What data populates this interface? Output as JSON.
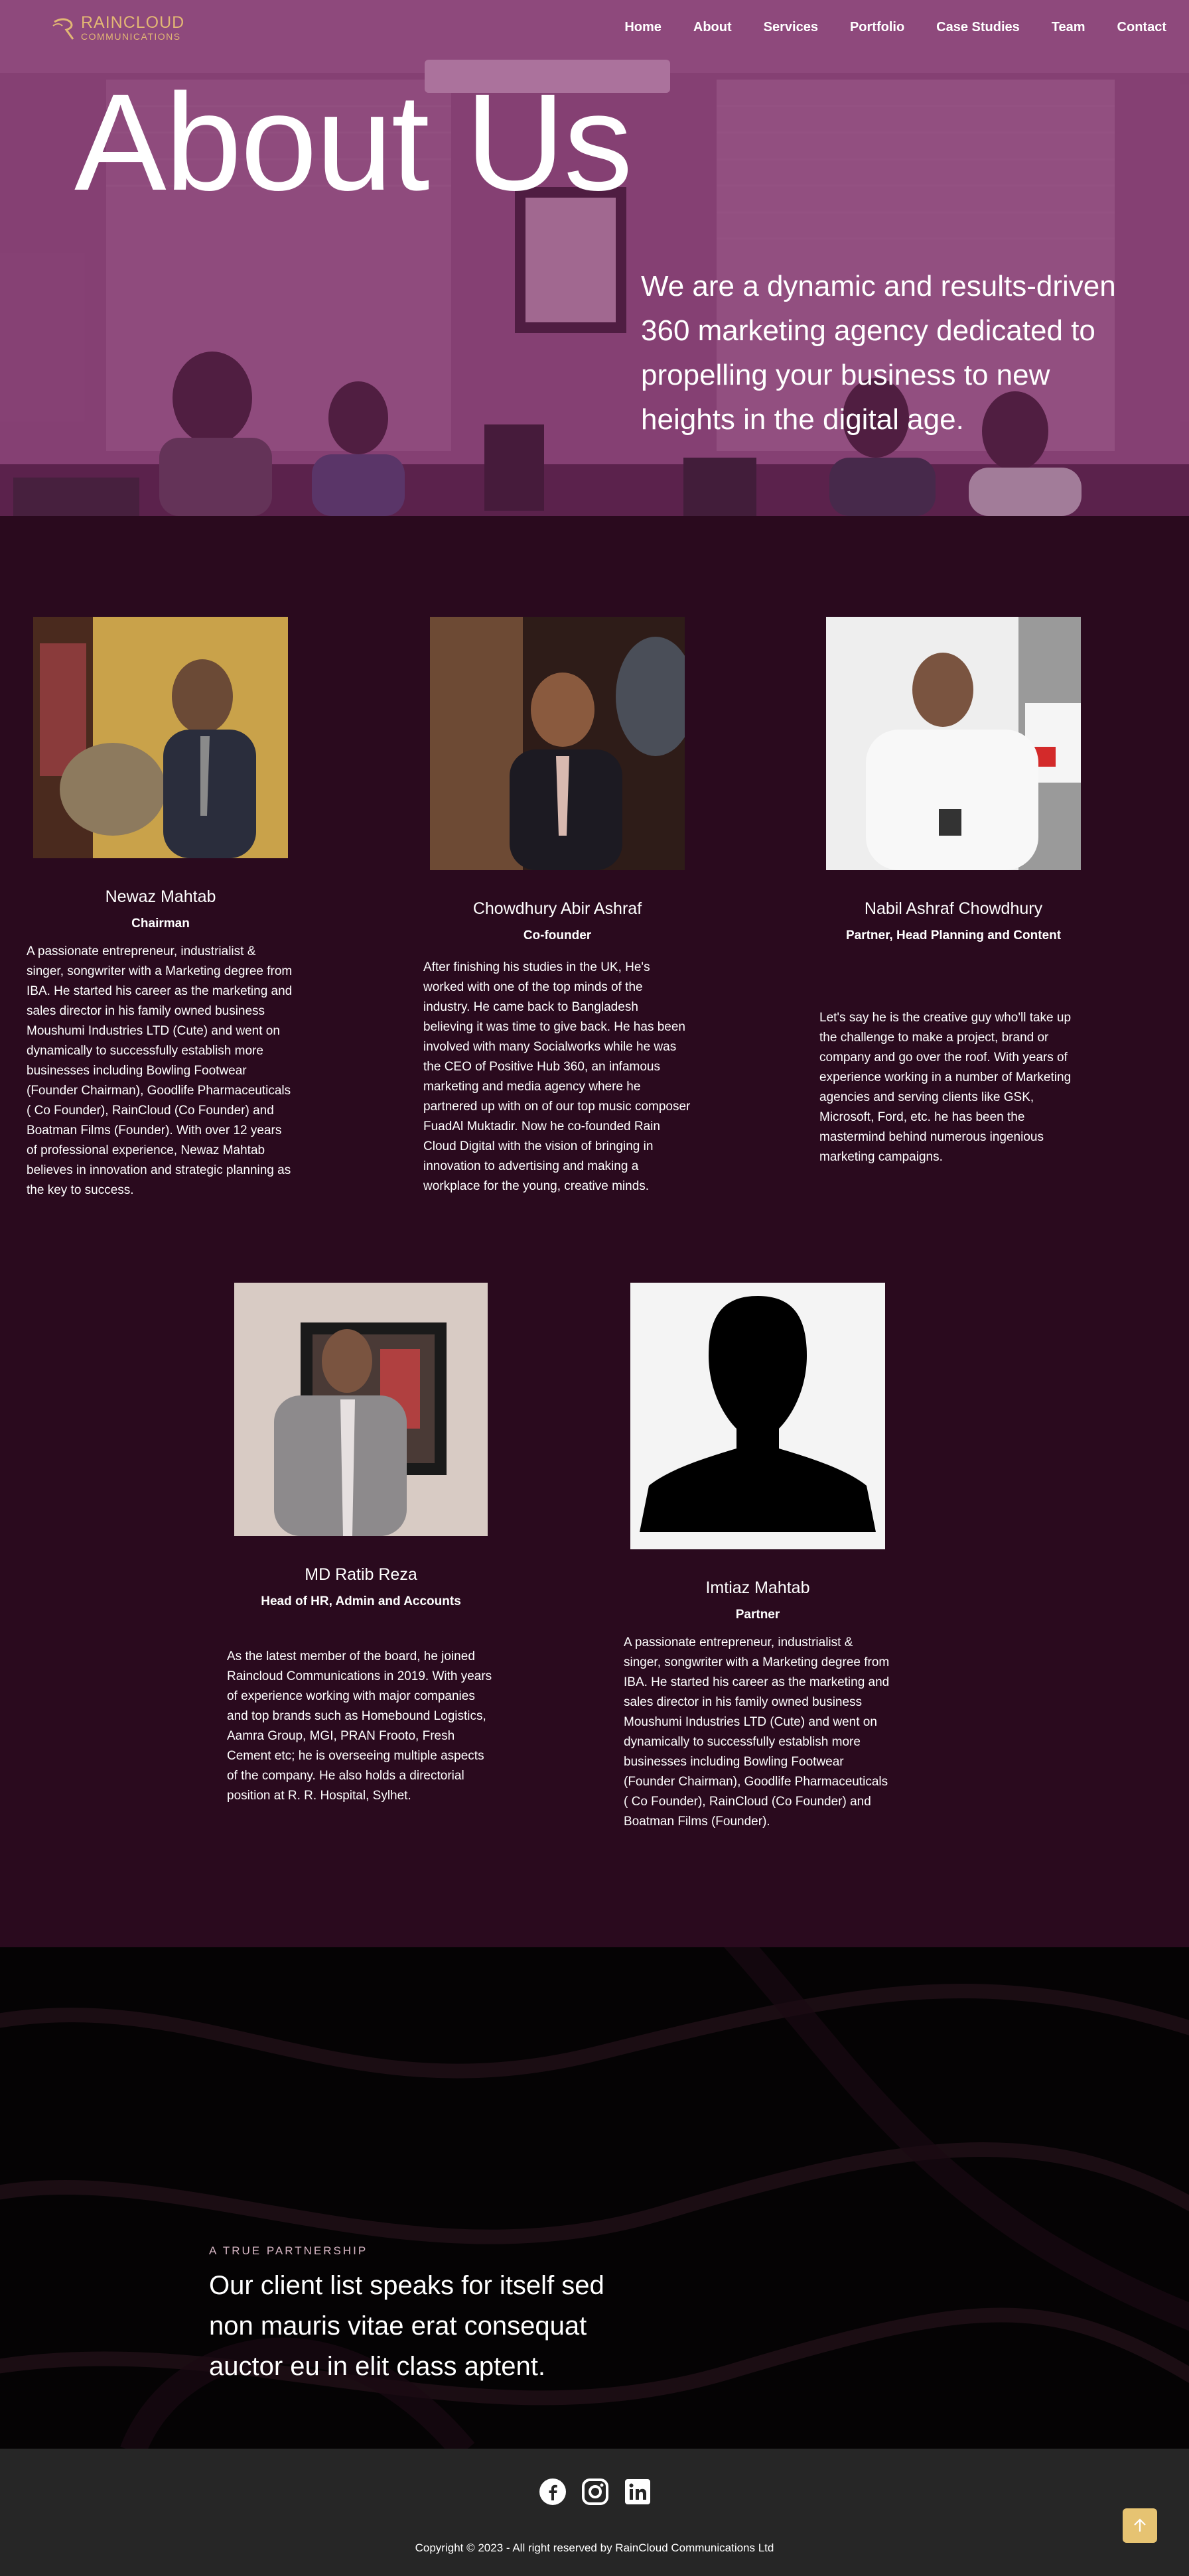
{
  "brand": {
    "name_line1": "RAINCLOUD",
    "name_line2": "COMMUNICATIONS",
    "accent": "#e2b774"
  },
  "nav": {
    "items": [
      "Home",
      "About",
      "Services",
      "Portfolio",
      "Case Studies",
      "Team",
      "Contact"
    ]
  },
  "hero": {
    "title": "About Us",
    "tagline": "We are a dynamic and results-driven 360 marketing agency dedicated to propelling your business to new heights in the digital age."
  },
  "team": [
    {
      "name": "Newaz Mahtab",
      "role": "Chairman",
      "bio": "A passionate entrepreneur, industrialist & singer, songwriter with a Marketing degree from IBA. He started his career as the marketing and sales director in his family owned business Moushumi Industries LTD (Cute) and went on dynamically to successfully establish more businesses including Bowling Footwear (Founder Chairman), Goodlife Pharmaceuticals ( Co Founder), RainCloud (Co Founder) and Boatman Films (Founder). With over 12 years of professional experience, Newaz Mahtab believes in innovation and strategic planning as the key to success.",
      "photo_icon": "portrait-photo"
    },
    {
      "name": "Chowdhury Abir Ashraf",
      "role": "Co-founder",
      "bio": "After finishing his studies in the UK, He's worked with one of the top minds of the industry. He came back to Bangladesh believing it was time to give back. He has been involved with many Socialworks while he was the CEO of Positive Hub 360, an infamous marketing and media agency where he partnered up with on of our top music composer FuadAl Muktadir. Now he co-founded Rain Cloud Digital with the vision of bringing in innovation to advertising and making a workplace for the young, creative minds.",
      "photo_icon": "portrait-photo"
    },
    {
      "name": "Nabil Ashraf Chowdhury",
      "role": "Partner, Head Planning and Content",
      "bio": "Let's say he is the creative guy who'll take up the challenge to make a project, brand or company and go over the roof. With years of experience working in a number of Marketing agencies and serving clients like GSK, Microsoft, Ford, etc. he has been the mastermind behind numerous ingenious marketing campaigns.",
      "photo_icon": "portrait-photo"
    },
    {
      "name": "MD Ratib Reza",
      "role": "Head of HR, Admin and Accounts",
      "bio": "As the latest member of the board, he joined Raincloud Communications in 2019. With years of experience working with major companies and top brands such as Homebound Logistics, Aamra Group, MGI, PRAN Frooto, Fresh Cement etc; he is overseeing multiple aspects of the company. He also holds a directorial position at R. R. Hospital, Sylhet.",
      "photo_icon": "portrait-photo"
    },
    {
      "name": "Imtiaz Mahtab",
      "role": "Partner",
      "bio": "A passionate entrepreneur, industrialist & singer, songwriter with a Marketing degree from IBA. He started his career as the marketing and sales director in his family owned business Moushumi Industries LTD (Cute) and went on dynamically to successfully establish more businesses including Bowling Footwear (Founder Chairman), Goodlife Pharmaceuticals ( Co Founder), RainCloud (Co Founder) and Boatman Films (Founder).",
      "photo_icon": "silhouette-placeholder"
    }
  ],
  "partnership": {
    "label": "A TRUE PARTNERSHIP",
    "headline": "Our client list speaks for itself sed non mauris vitae erat consequat auctor eu in elit class aptent."
  },
  "footer": {
    "social_icons": [
      "facebook-icon",
      "instagram-icon",
      "linkedin-icon"
    ],
    "copyright": "Copyright © 2023 - All right reserved by RainCloud Communications Ltd",
    "back_to_top_icon": "arrow-up-icon"
  },
  "colors": {
    "team_bg": "#2a0a1e",
    "partner_bg": "#050304",
    "footer_bg": "#262626",
    "back_to_top": "#e6c372"
  }
}
